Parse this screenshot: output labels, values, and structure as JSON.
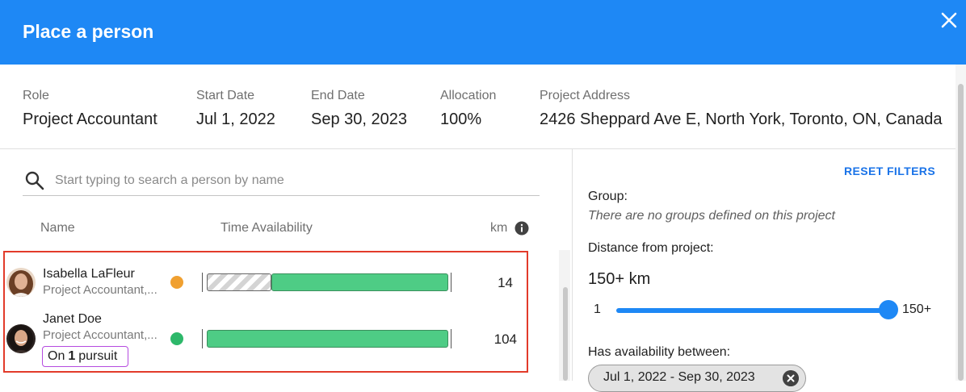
{
  "dialog": {
    "title": "Place a person"
  },
  "info": [
    {
      "label": "Role",
      "value": "Project Accountant"
    },
    {
      "label": "Start Date",
      "value": "Jul 1, 2022"
    },
    {
      "label": "End Date",
      "value": "Sep 30, 2023"
    },
    {
      "label": "Allocation",
      "value": "100%"
    },
    {
      "label": "Project Address",
      "value": "2426 Sheppard Ave E, North York, Toronto, ON, Canada"
    }
  ],
  "search": {
    "placeholder": "Start typing to search a person by name",
    "value": ""
  },
  "columns": {
    "name": "Name",
    "availability": "Time Availability",
    "km": "km"
  },
  "people": [
    {
      "name": "Isabella LaFleur",
      "role": "Project Accountant,...",
      "status_color": "#f0a030",
      "km": "14",
      "pursuit": null
    },
    {
      "name": "Janet Doe",
      "role": "Project Accountant,...",
      "status_color": "#2db86a",
      "km": "104",
      "pursuit": {
        "prefix": "On",
        "count": "1",
        "suffix": "pursuit"
      }
    }
  ],
  "filters": {
    "reset_label": "RESET FILTERS",
    "group_label": "Group:",
    "group_note": "There are no groups defined on this project",
    "distance_label": "Distance from project:",
    "distance_value": "150+ km",
    "slider_min": "1",
    "slider_max": "150+",
    "availability_label": "Has availability between:",
    "availability_chip": "Jul 1, 2022 - Sep 30, 2023"
  },
  "colors": {
    "header": "#1e88f5",
    "accent": "#1a73e8",
    "available": "#4ecc85",
    "highlight": "#e23b2a"
  },
  "icons": [
    "close-icon",
    "search-icon",
    "info-icon",
    "chip-remove-icon"
  ]
}
